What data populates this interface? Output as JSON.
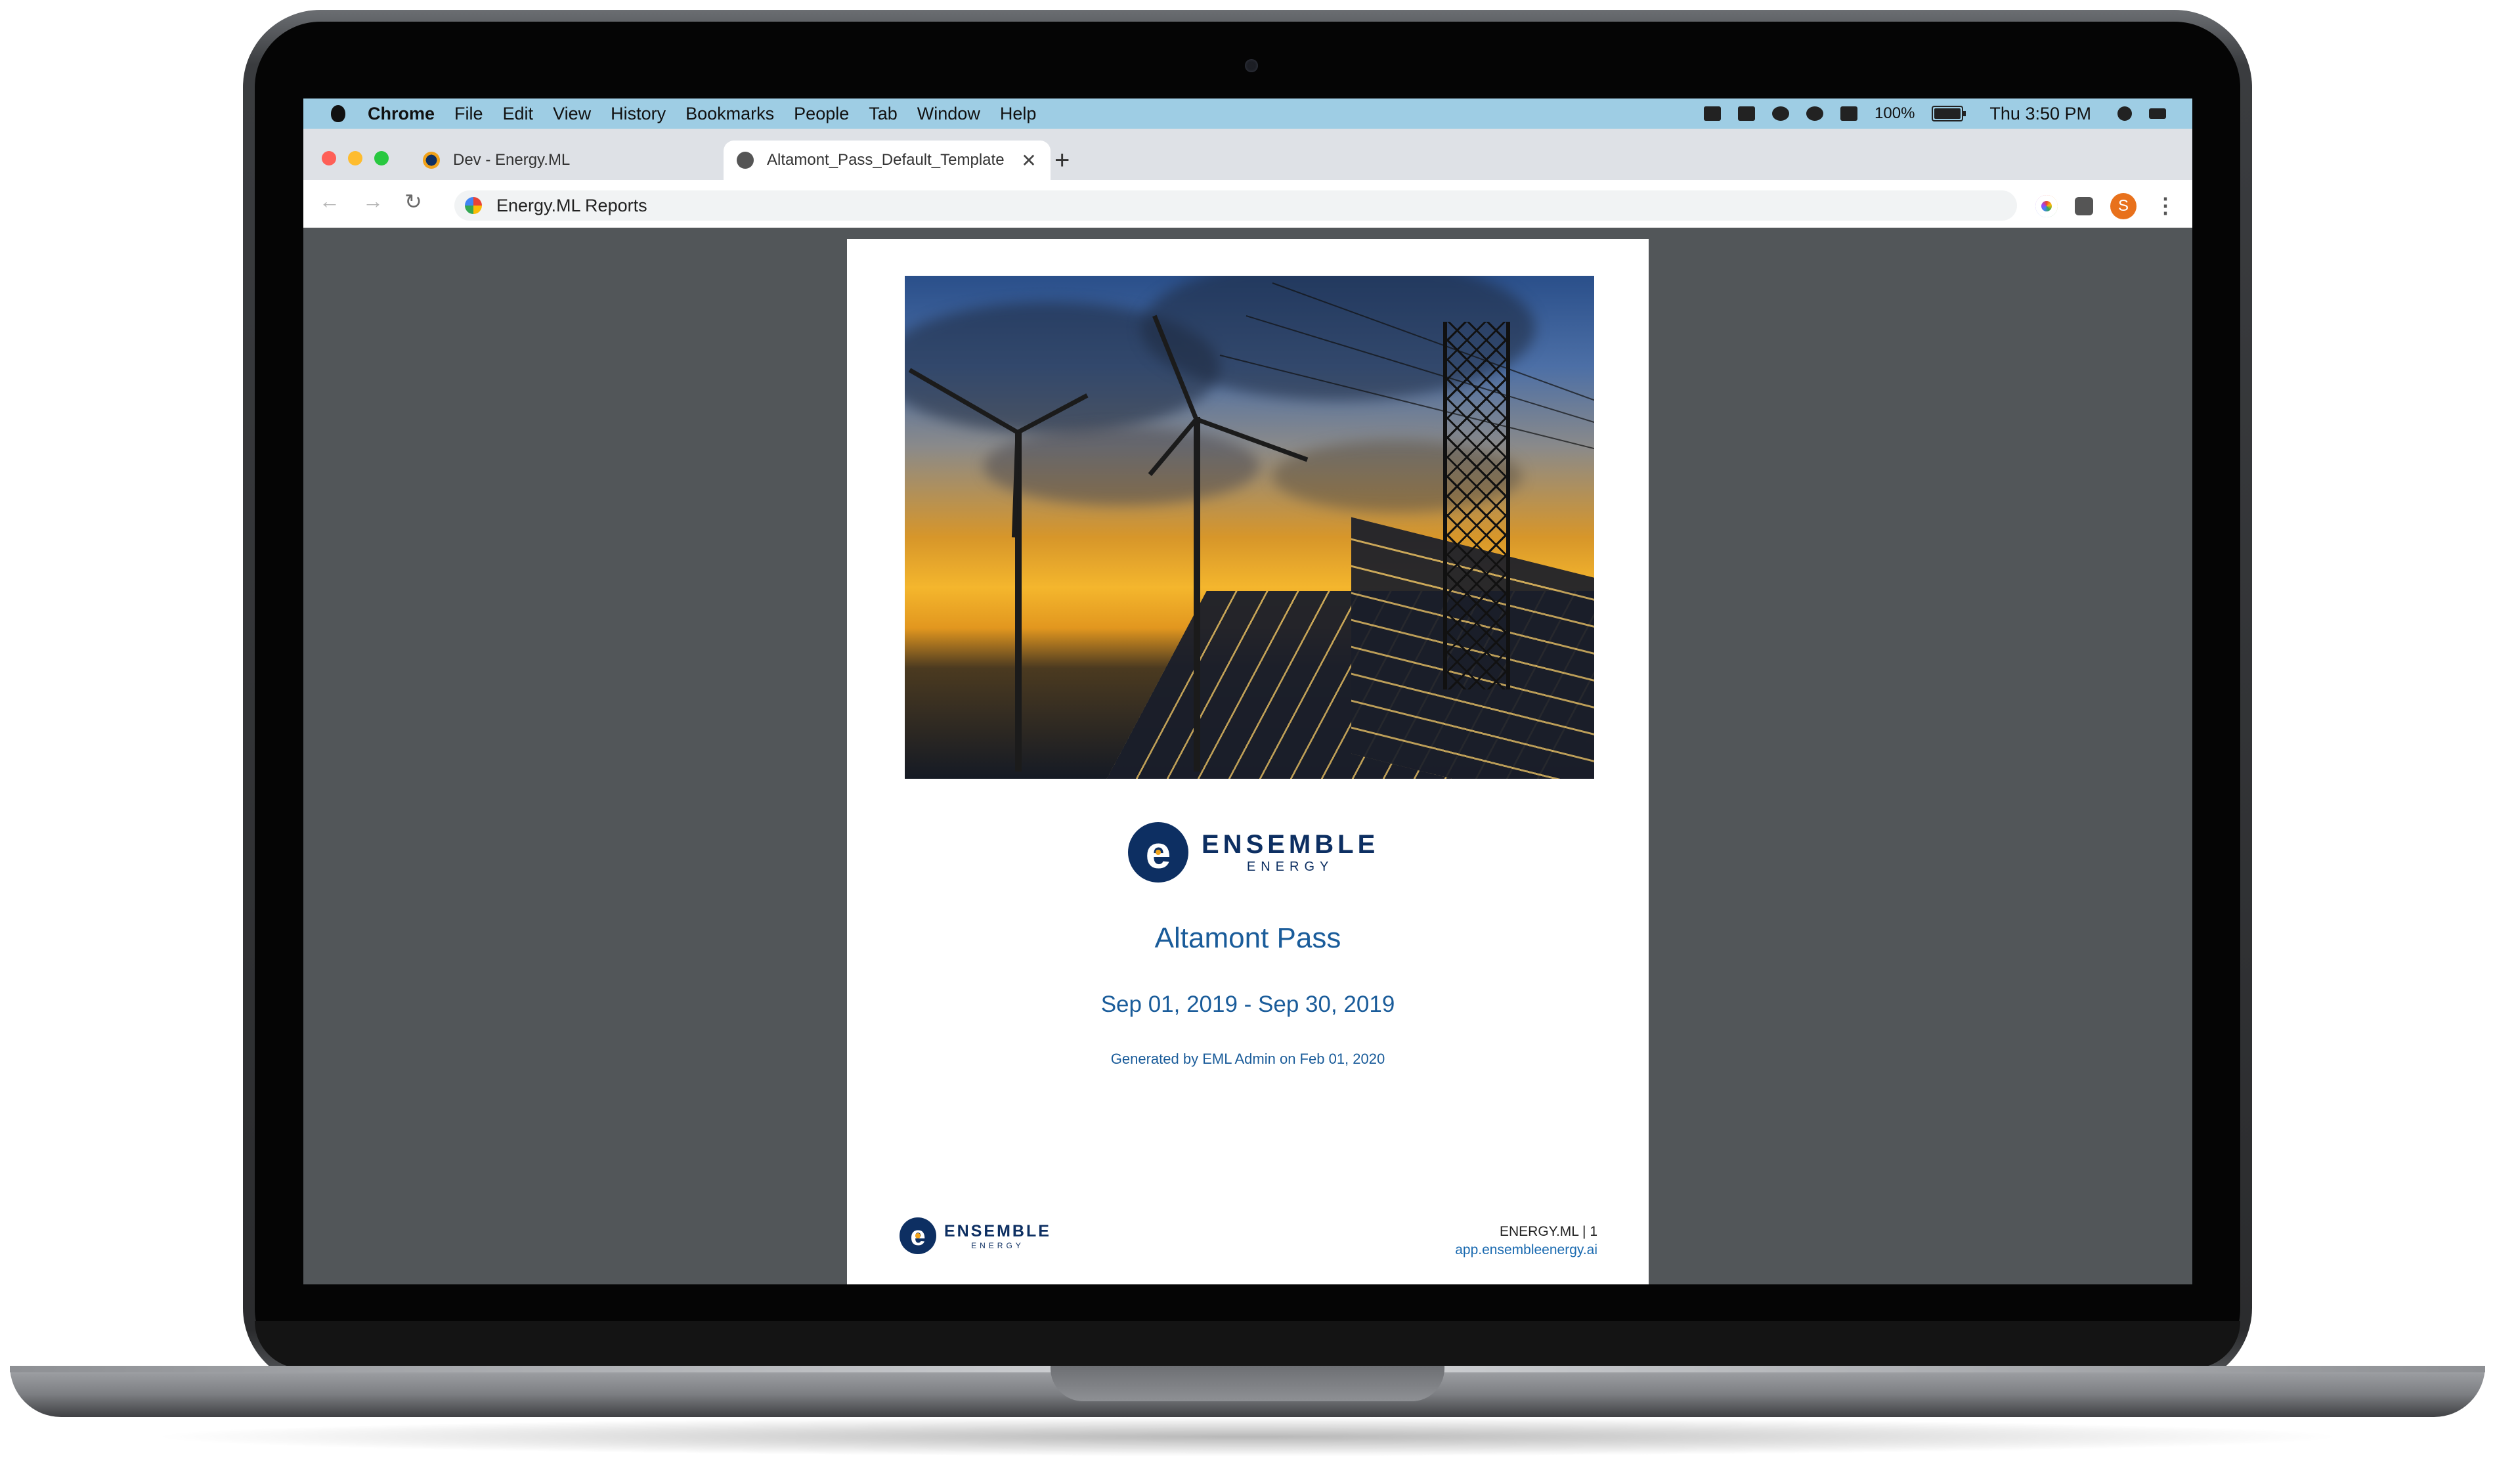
{
  "menubar": {
    "items": [
      "Chrome",
      "File",
      "Edit",
      "View",
      "History",
      "Bookmarks",
      "People",
      "Tab",
      "Window",
      "Help"
    ],
    "battery_percent": "100%",
    "battery_level": 1.0,
    "clock": "Thu 3:50 PM",
    "status_icons": [
      "dropbox-icon",
      "docker-icon",
      "vpn-icon",
      "wifi-icon",
      "volume-icon",
      "battery-icon",
      "search-icon",
      "control-center-icon"
    ]
  },
  "tabs": [
    {
      "title": "Dev - Energy.ML",
      "active": false,
      "favicon": "ensemble-favicon-icon"
    },
    {
      "title": "Altamont_Pass_Default_Template",
      "active": true,
      "favicon": "globe-icon"
    }
  ],
  "toolbar": {
    "omnibox_text": "Energy.ML Reports",
    "avatar_initial": "S"
  },
  "report": {
    "brand_line1": "ENSEMBLE",
    "brand_line2": "ENERGY",
    "brand_mark": "e",
    "site_name": "Altamont Pass",
    "date_range": "Sep 01, 2019 - Sep 30, 2019",
    "generated": "Generated by EML Admin on Feb 01, 2020",
    "footer_product": "ENERGY.ML | 1",
    "footer_url": "app.ensembleenergy.ai"
  },
  "colors": {
    "menubar_bg": "#9ecde4",
    "brand_navy": "#0d2f62",
    "brand_orange": "#f0a21a",
    "title_blue": "#1a5c9a",
    "viewer_bg": "#525659"
  }
}
